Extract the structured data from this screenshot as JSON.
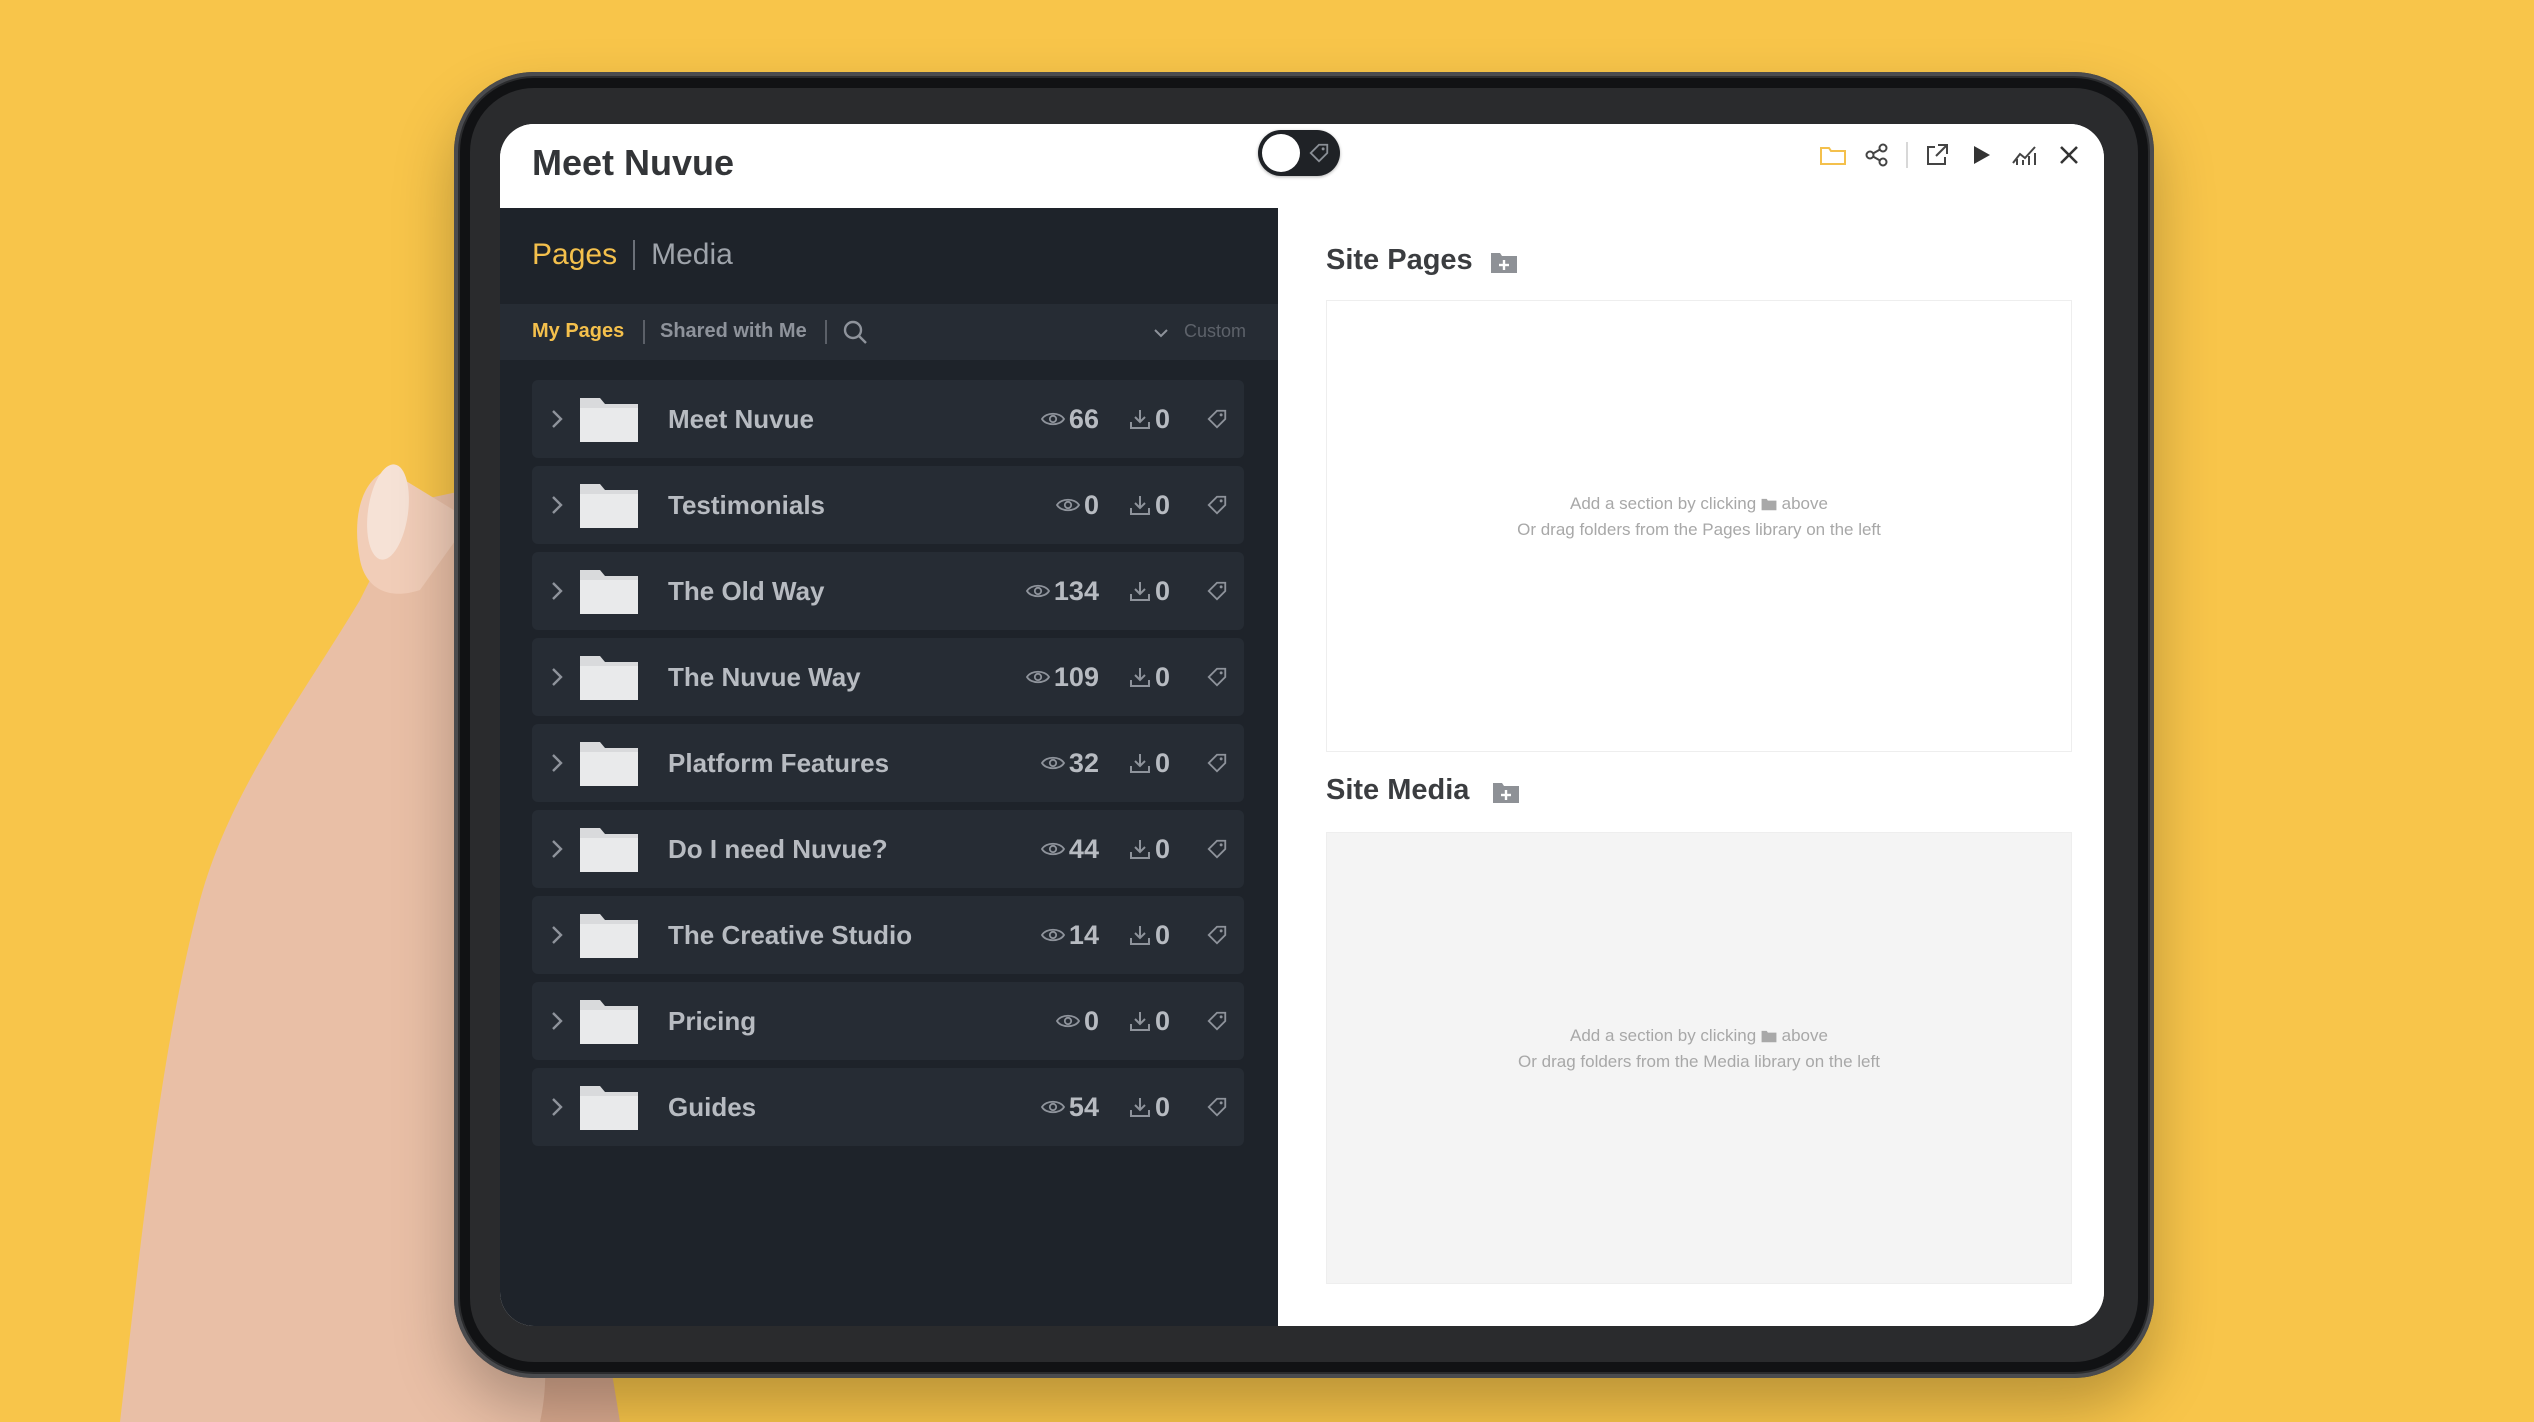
{
  "app": {
    "title": "Meet Nuvue"
  },
  "library_tabs": {
    "pages": "Pages",
    "media": "Media"
  },
  "filters": {
    "my_pages": "My Pages",
    "shared": "Shared with Me",
    "sort": "Custom"
  },
  "folders": [
    {
      "name": "Meet Nuvue",
      "views": "66",
      "downloads": "0"
    },
    {
      "name": "Testimonials",
      "views": "0",
      "downloads": "0"
    },
    {
      "name": "The Old Way",
      "views": "134",
      "downloads": "0"
    },
    {
      "name": "The Nuvue Way",
      "views": "109",
      "downloads": "0"
    },
    {
      "name": "Platform Features",
      "views": "32",
      "downloads": "0"
    },
    {
      "name": "Do I need Nuvue?",
      "views": "44",
      "downloads": "0"
    },
    {
      "name": "The Creative Studio",
      "views": "14",
      "downloads": "0"
    },
    {
      "name": "Pricing",
      "views": "0",
      "downloads": "0"
    },
    {
      "name": "Guides",
      "views": "54",
      "downloads": "0"
    }
  ],
  "site_pages": {
    "title": "Site Pages",
    "hint_line1_a": "Add a section by clicking",
    "hint_line1_b": "above",
    "hint_line2": "Or drag folders from the Pages library on the left"
  },
  "site_media": {
    "title": "Site Media",
    "hint_line1_a": "Add a section by clicking",
    "hint_line1_b": "above",
    "hint_line2": "Or drag folders from the Media library on the left"
  },
  "colors": {
    "accent": "#F4C04C",
    "background": "#F8C54A",
    "panel_dark": "#1e232a",
    "row_dark": "#262c34"
  },
  "icons": [
    "folder-icon",
    "share-icon",
    "external-link-icon",
    "play-icon",
    "analytics-icon",
    "close-icon",
    "eye-icon",
    "download-icon",
    "tag-icon",
    "search-icon",
    "chevron-right-icon",
    "chevron-down-icon",
    "add-folder-icon"
  ]
}
